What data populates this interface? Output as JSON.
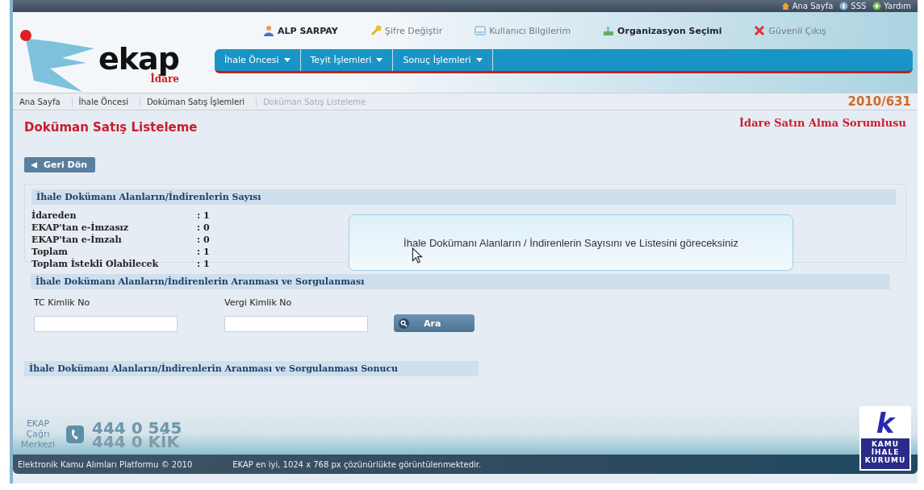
{
  "top_links": [
    {
      "label": "Ana Sayfa"
    },
    {
      "label": "SSS"
    },
    {
      "label": "Yardım"
    }
  ],
  "user_links": [
    {
      "label": "ALP SARPAY",
      "strong": true
    },
    {
      "label": "Şifre Değiştir",
      "strong": false
    },
    {
      "label": "Kullanıcı Bilgilerim",
      "strong": false
    },
    {
      "label": "Organizasyon Seçimi",
      "strong": true
    },
    {
      "label": "Güvenli Çıkış",
      "strong": false
    }
  ],
  "logo": {
    "name": "ekap",
    "sub": "İdare"
  },
  "nav": [
    "İhale Öncesi",
    "Teyit İşlemleri",
    "Sonuç İşlemleri"
  ],
  "breadcrumbs": [
    {
      "label": "Ana Sayfa",
      "current": false
    },
    {
      "label": "İhale Öncesi",
      "current": false
    },
    {
      "label": "Doküman Satış İşlemleri",
      "current": false
    },
    {
      "label": "Doküman Satış Listeleme",
      "current": true
    }
  ],
  "record_no": "2010/631",
  "page_title": "Doküman Satış Listeleme",
  "role": "İdare Satın Alma Sorumlusu",
  "back_button": "Geri Dön",
  "count_section": {
    "title": "İhale Dokümanı Alanların/İndirenlerin Sayısı",
    "rows": [
      {
        "label": "İdareden",
        "value": ": 1"
      },
      {
        "label": "EKAP'tan e-İmzasız",
        "value": ": 0"
      },
      {
        "label": "EKAP'tan e-İmzalı",
        "value": ": 0"
      },
      {
        "label": "Toplam",
        "value": ": 1"
      },
      {
        "label": "Toplam İstekli Olabilecek",
        "value": ": 1"
      }
    ]
  },
  "tooltip": "İhale Dokümanı Alanların / İndirenlerin Sayısını ve Listesini göreceksiniz",
  "search_section": {
    "title": "İhale Dokümanı Alanların/İndirenlerin Aranması ve Sorgulanması",
    "fields": [
      {
        "label": "TC Kimlik No"
      },
      {
        "label": "Vergi Kimlik No"
      }
    ],
    "button": "Ara"
  },
  "result_section": {
    "title": "İhale Dokümanı Alanların/İndirenlerin Aranması ve Sorgulanması Sonucu"
  },
  "call_center": {
    "label": "EKAP Çağrı Merkezi",
    "phone": "444 0 545",
    "phone_letters": "444 0 KİK"
  },
  "agency_logo": {
    "letter": "k",
    "name": "KAMU İHALE KURUMU"
  },
  "footer": {
    "copyright": "Elektronik Kamu Alımları Platformu © 2010",
    "note": "EKAP en iyi, 1024 x 768 px çözünürlükte görüntülenmektedir."
  }
}
